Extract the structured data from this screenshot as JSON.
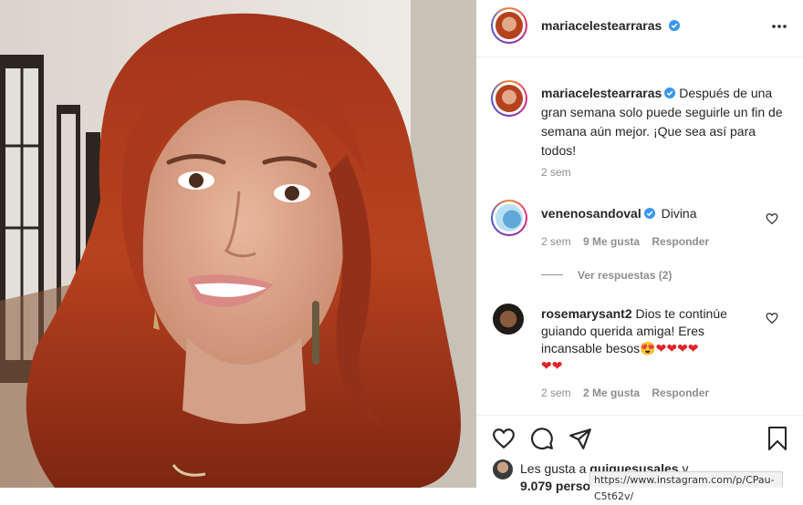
{
  "post": {
    "username": "mariacelestearraras",
    "more_icon": "more-horizontal-icon",
    "caption_user": "mariacelestearraras",
    "caption_text": "Después de una gran semana solo puede seguirle un fin de semana aún mejor. ¡Que sea así para todos!",
    "caption_time": "2 sem"
  },
  "comments": [
    {
      "user": "venenosandoval",
      "verified": true,
      "text": "Divina",
      "time": "2 sem",
      "likes": "9 Me gusta",
      "reply": "Responder",
      "view_replies": "Ver respuestas (2)"
    },
    {
      "user": "rosemarysant2",
      "verified": false,
      "text_line1": "Dios te continúe",
      "text_line2": "guiando querida amiga! Eres",
      "text_line3": "incansable besos",
      "emojis_line3": "😍❤❤❤❤",
      "emojis_line4": "❤❤",
      "time": "2 sem",
      "likes": "2 Me gusta",
      "reply": "Responder"
    }
  ],
  "likes": {
    "prefix": "Les gusta a",
    "user": "quiquesusales",
    "suffix": "y",
    "count_prefix": "9.079 perso"
  },
  "status_url": "https://www.instagram.com/p/CPau-C5t62v/",
  "colors": {
    "verified": "#3897f0",
    "muted": "#8e8e8e",
    "text": "#262626",
    "heart": "#e0242c"
  }
}
